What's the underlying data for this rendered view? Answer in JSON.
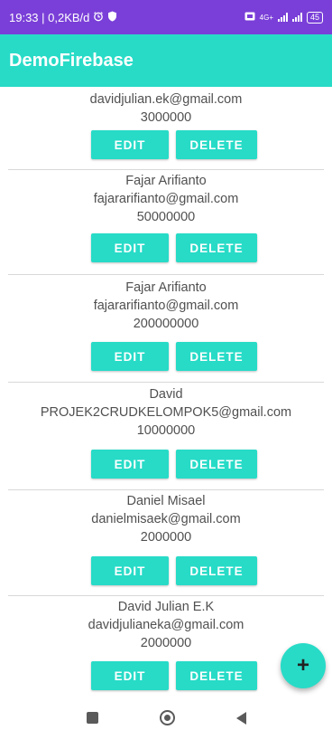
{
  "status_bar": {
    "time_info": "19:33 | 0,2KB/d",
    "network_label": "4G+",
    "battery": "45"
  },
  "app_bar": {
    "title": "DemoFirebase"
  },
  "buttons": {
    "edit": "EDIT",
    "delete": "DELETE"
  },
  "items": [
    {
      "name": "",
      "email": "davidjulian.ek@gmail.com",
      "amount": "3000000"
    },
    {
      "name": "Fajar Arifianto",
      "email": "fajararifianto@gmail.com",
      "amount": "50000000"
    },
    {
      "name": "Fajar Arifianto",
      "email": "fajararifianto@gmail.com",
      "amount": "200000000"
    },
    {
      "name": "David",
      "email": "PROJEK2CRUDKELOMPOK5@gmail.com",
      "amount": "10000000"
    },
    {
      "name": "Daniel Misael",
      "email": "danielmisaek@gmail.com",
      "amount": "2000000"
    },
    {
      "name": "David Julian E.K",
      "email": "davidjulianeka@gmail.com",
      "amount": "2000000"
    }
  ],
  "fab": {
    "icon": "plus-icon",
    "label": "+"
  },
  "nav": {
    "icons": [
      "recents-square-icon",
      "home-circle-icon",
      "back-triangle-icon"
    ]
  },
  "colors": {
    "accent": "#27dbc7",
    "status_bar": "#7a3fd8"
  }
}
